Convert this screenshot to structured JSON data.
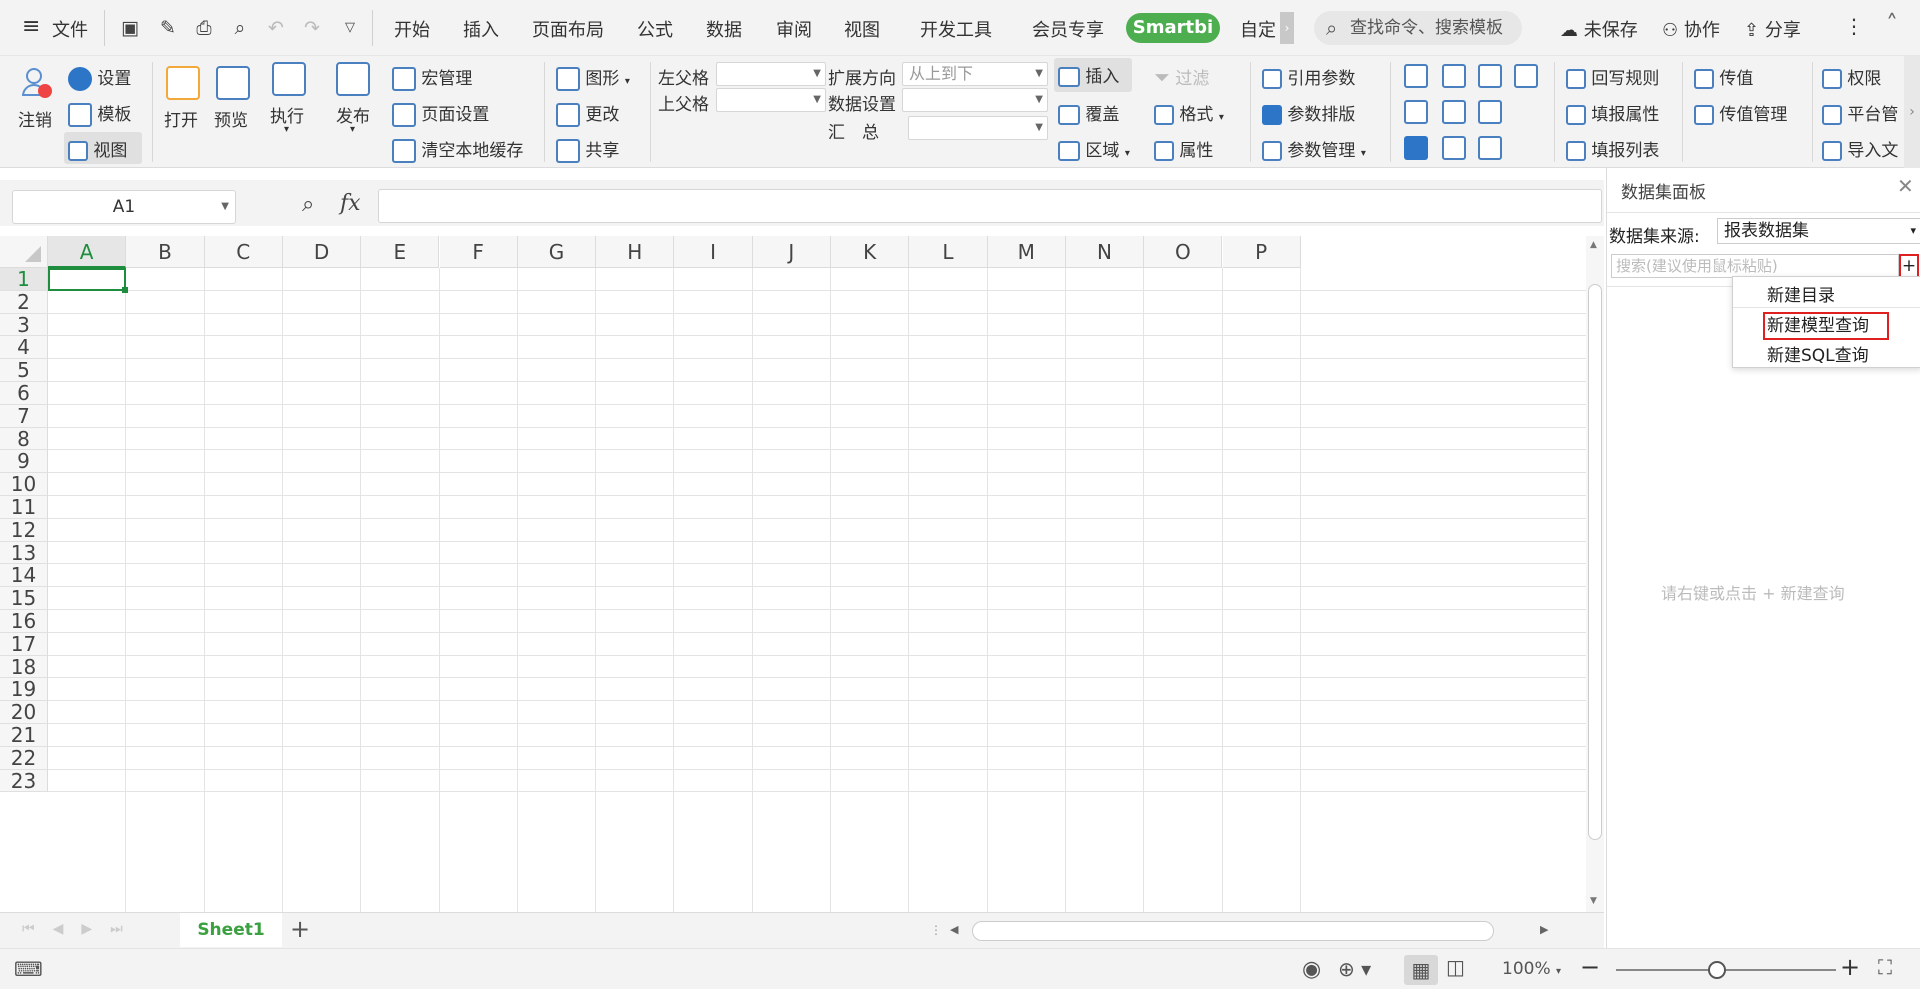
{
  "titlebar": {
    "file_label": "文件",
    "tabs": [
      "开始",
      "插入",
      "页面布局",
      "公式",
      "数据",
      "审阅",
      "视图",
      "开发工具",
      "会员专享"
    ],
    "smartbi_tab": "Smartbi",
    "custom_tab": "自定",
    "search_placeholder": "查找命令、搜索模板",
    "unsaved": "未保存",
    "collaborate": "协作",
    "share": "分享"
  },
  "ribbon": {
    "logout": "注销",
    "settings": "设置",
    "template": "模板",
    "view": "视图",
    "open": "打开",
    "preview": "预览",
    "execute": "执行",
    "publish": "发布",
    "macro_manage": "宏管理",
    "page_settings": "页面设置",
    "clear_cache": "清空本地缓存",
    "chart": "图形",
    "change": "更改",
    "share": "共享",
    "left_parent": "左父格",
    "top_parent": "上父格",
    "expand_dir": "扩展方向",
    "expand_value": "从上到下",
    "data_settings": "数据设置",
    "summary": "汇　总",
    "insert": "插入",
    "cover": "覆盖",
    "region": "区域",
    "filter": "过滤",
    "format": "格式",
    "property": "属性",
    "ref_param": "引用参数",
    "param_layout": "参数排版",
    "param_manage": "参数管理",
    "writeback_rule": "回写规则",
    "fill_property": "填报属性",
    "fill_list": "填报列表",
    "pass_value": "传值",
    "pass_manage": "传值管理",
    "permission": "权限",
    "platform": "平台管",
    "import": "导入文"
  },
  "formula": {
    "cell_ref": "A1",
    "fx": "fx",
    "value": ""
  },
  "grid": {
    "columns": [
      "A",
      "B",
      "C",
      "D",
      "E",
      "F",
      "G",
      "H",
      "I",
      "J",
      "K",
      "L",
      "M",
      "N",
      "O",
      "P"
    ],
    "rows": [
      "1",
      "2",
      "3",
      "4",
      "5",
      "6",
      "7",
      "8",
      "9",
      "10",
      "11",
      "12",
      "13",
      "14",
      "15",
      "16",
      "17",
      "18",
      "19",
      "20",
      "21",
      "22",
      "23"
    ],
    "active_cell": "A1"
  },
  "sheets": {
    "active": "Sheet1",
    "add": "+"
  },
  "status": {
    "zoom": "100%",
    "minus": "−",
    "plus": "+"
  },
  "panel": {
    "title": "数据集面板",
    "source_label": "数据集来源:",
    "source_value": "报表数据集",
    "search_placeholder": "搜索(建议使用鼠标粘贴)",
    "add": "+",
    "hint": "请右键或点击 + 新建查询",
    "menu": [
      "新建目录",
      "新建模型查询",
      "新建SQL查询"
    ]
  },
  "colors": {
    "accent": "#4cae4f",
    "highlight": "#e02020",
    "active_cell": "#1e8e3e"
  }
}
